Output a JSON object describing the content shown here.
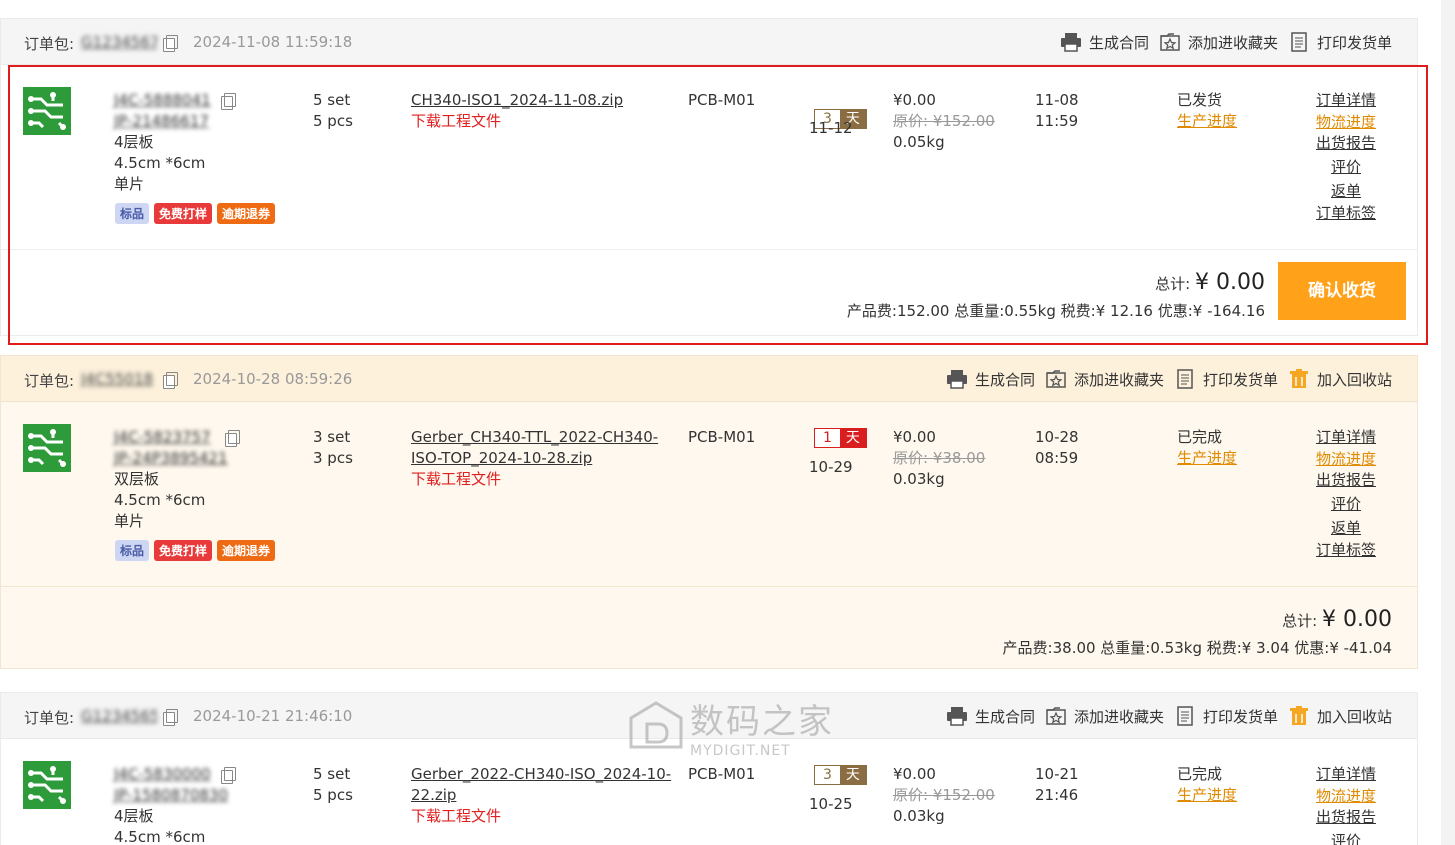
{
  "orders": [
    {
      "package_label": "订单包:",
      "package_id": "G12345679",
      "datetime": "2024-11-08 11:59:18",
      "actions": [
        "生成合同",
        "添加进收藏夹",
        "打印发货单"
      ],
      "item": {
        "id_line1": "J4C-5888041",
        "id_line2": "JP-21486617",
        "layers": "4层板",
        "size": "4.5cm *6cm",
        "panel": "单片",
        "tags": [
          "标品",
          "免费打样",
          "逾期退券"
        ],
        "qty_set": "5 set",
        "qty_pcs": "5 pcs",
        "file": "CH340-ISO1_2024-11-08.zip",
        "download": "下载工程文件",
        "model": "PCB-M01",
        "days_num": "3",
        "days_unit": "天",
        "delivery_date": "11-12",
        "price": "¥0.00",
        "original_price": "原价: ¥152.00",
        "weight": "0.05kg",
        "order_date": "11-08",
        "order_time": "11:59",
        "status": "已发货",
        "progress_link": "生产进度",
        "ops": [
          "订单详情",
          "物流进度",
          "出货报告",
          "评价",
          "返单",
          "订单标签"
        ]
      },
      "summary": {
        "total_label": "总计:",
        "total_value": "¥ 0.00",
        "detail": "产品费:152.00 总重量:0.55kg 税费:¥ 12.16 优惠:¥ -164.16",
        "confirm": "确认收货"
      }
    },
    {
      "package_label": "订单包:",
      "package_id": "J4C55018",
      "datetime": "2024-10-28 08:59:26",
      "actions": [
        "生成合同",
        "添加进收藏夹",
        "打印发货单",
        "加入回收站"
      ],
      "item": {
        "id_line1": "J4C-5823757",
        "id_line2": "JP-24P3895421",
        "layers": "双层板",
        "size": "4.5cm *6cm",
        "panel": "单片",
        "tags": [
          "标品",
          "免费打样",
          "逾期退券"
        ],
        "qty_set": "3 set",
        "qty_pcs": "3 pcs",
        "file": "Gerber_CH340-TTL_2022-CH340-ISO-TOP_2024-10-28.zip",
        "file_line1": "Gerber_CH340-TTL_2022-CH340-",
        "file_line2": "ISO-TOP_2024-10-28.zip",
        "download": "下载工程文件",
        "model": "PCB-M01",
        "days_num": "1",
        "days_unit": "天",
        "delivery_date": "10-29",
        "price": "¥0.00",
        "original_price": "原价: ¥38.00",
        "weight": "0.03kg",
        "order_date": "10-28",
        "order_time": "08:59",
        "status": "已完成",
        "progress_link": "生产进度",
        "ops": [
          "订单详情",
          "物流进度",
          "出货报告",
          "评价",
          "返单",
          "订单标签"
        ]
      },
      "summary": {
        "total_label": "总计:",
        "total_value": "¥ 0.00",
        "detail": "产品费:38.00 总重量:0.53kg 税费:¥ 3.04 优惠:¥ -41.04"
      }
    },
    {
      "package_label": "订单包:",
      "package_id": "G1234565",
      "datetime": "2024-10-21 21:46:10",
      "actions": [
        "生成合同",
        "添加进收藏夹",
        "打印发货单",
        "加入回收站"
      ],
      "item": {
        "id_line1": "J4C-5830000",
        "id_line2": "JP-1580870830",
        "layers": "4层板",
        "size": "4.5cm *6cm",
        "qty_set": "5 set",
        "qty_pcs": "5 pcs",
        "file_line1": "Gerber_2022-CH340-ISO_2024-10-",
        "file_line2": "22.zip",
        "download": "下载工程文件",
        "model": "PCB-M01",
        "days_num": "3",
        "days_unit": "天",
        "delivery_date": "10-25",
        "price": "¥0.00",
        "original_price": "原价: ¥152.00",
        "weight": "0.03kg",
        "order_date": "10-21",
        "order_time": "21:46",
        "status": "已完成",
        "progress_link": "生产进度",
        "ops": [
          "订单详情",
          "物流进度",
          "出货报告",
          "评价"
        ]
      }
    }
  ],
  "watermark": {
    "title": "数码之家",
    "subtitle": "MYDIGIT.NET"
  },
  "colors": {
    "accent": "#ffa119",
    "highlight": "#e01b1b",
    "link_orange": "#e08a00",
    "download_red": "#e02020"
  }
}
